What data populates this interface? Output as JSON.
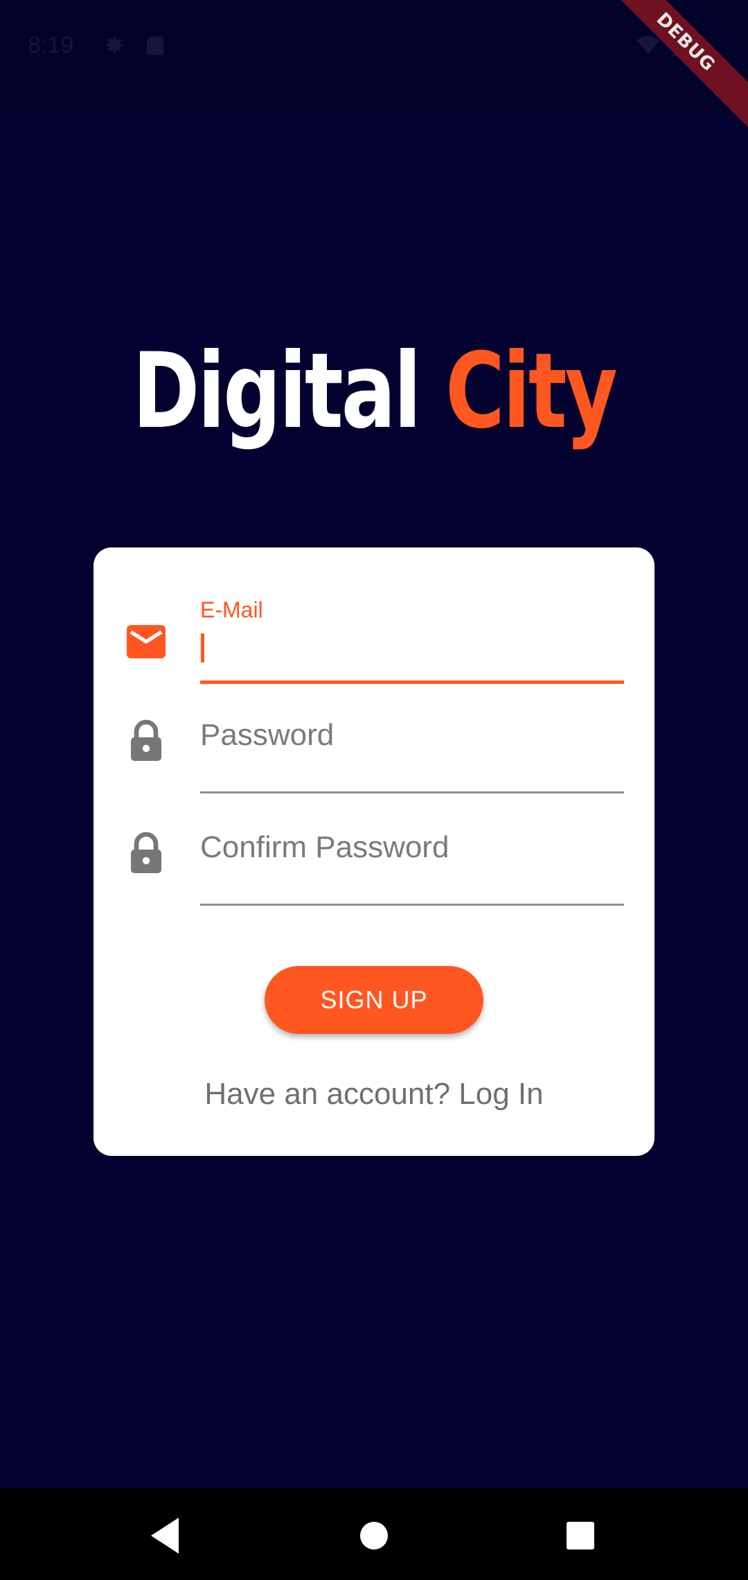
{
  "status_bar": {
    "time": "8:19",
    "icons": [
      "settings-icon",
      "sd-card-icon",
      "wifi-icon",
      "signal-icon",
      "battery-icon"
    ],
    "debug_label": "DEBUG"
  },
  "logo": {
    "part1": "Digital",
    "part2": "City"
  },
  "form": {
    "email": {
      "label": "E-Mail",
      "value": "",
      "icon": "mail-icon"
    },
    "password": {
      "placeholder": "Password",
      "value": "",
      "icon": "lock-icon"
    },
    "confirm_password": {
      "placeholder": "Confirm Password",
      "value": "",
      "icon": "lock-icon"
    },
    "signup_label": "SIGN UP",
    "login_link": "Have an account? Log In"
  },
  "nav_bar": {
    "buttons": [
      "back-icon",
      "home-icon",
      "recents-icon"
    ]
  },
  "colors": {
    "background": "#020130",
    "accent": "#ff5722",
    "card": "#ffffff",
    "muted": "#7a7a7a"
  }
}
